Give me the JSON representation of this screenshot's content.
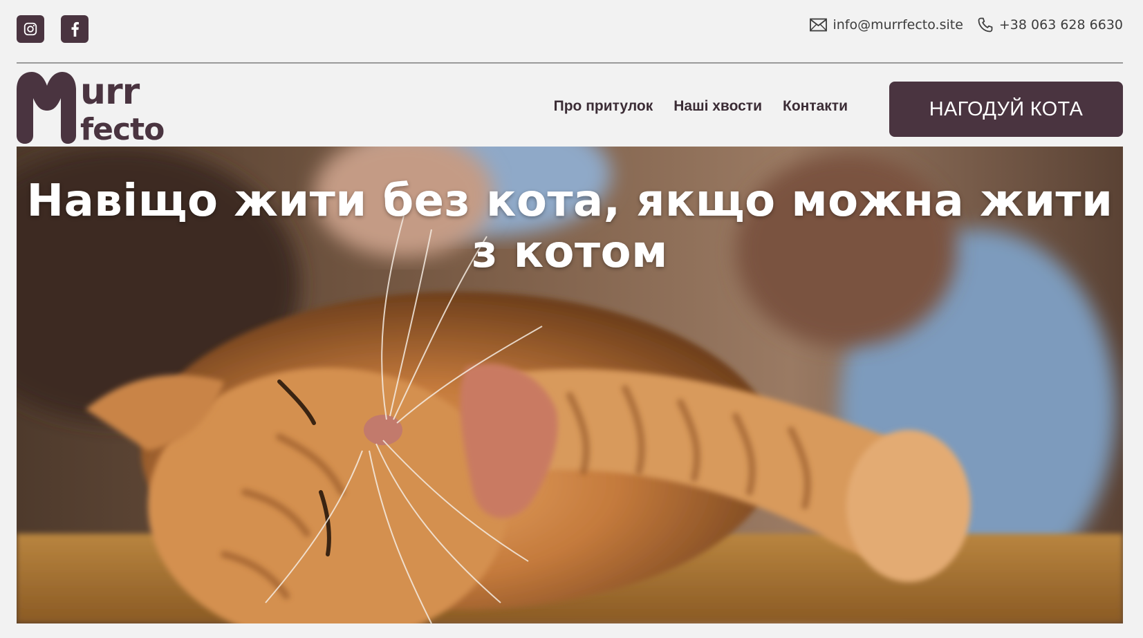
{
  "social": {
    "instagram_icon": "instagram-icon",
    "facebook_icon": "facebook-icon"
  },
  "contact": {
    "email": "info@murrfecto.site",
    "phone": "+38 063 628 6630",
    "email_icon": "envelope-icon",
    "phone_icon": "phone-icon"
  },
  "logo": {
    "alt": "Murr Mfecto",
    "line1": "urr",
    "line2": "fecto",
    "letter": "M"
  },
  "nav": {
    "items": [
      {
        "label": "Про притулок"
      },
      {
        "label": "Наші хвости"
      },
      {
        "label": "Контакти"
      }
    ]
  },
  "cta": {
    "label": "НАГОДУЙ КОТА"
  },
  "hero": {
    "title": "Навіщо жити без кота, якщо можна жити з котом"
  },
  "colors": {
    "brand": "#4a3440",
    "background": "#f2f2f2",
    "text": "#3c3c3c"
  }
}
